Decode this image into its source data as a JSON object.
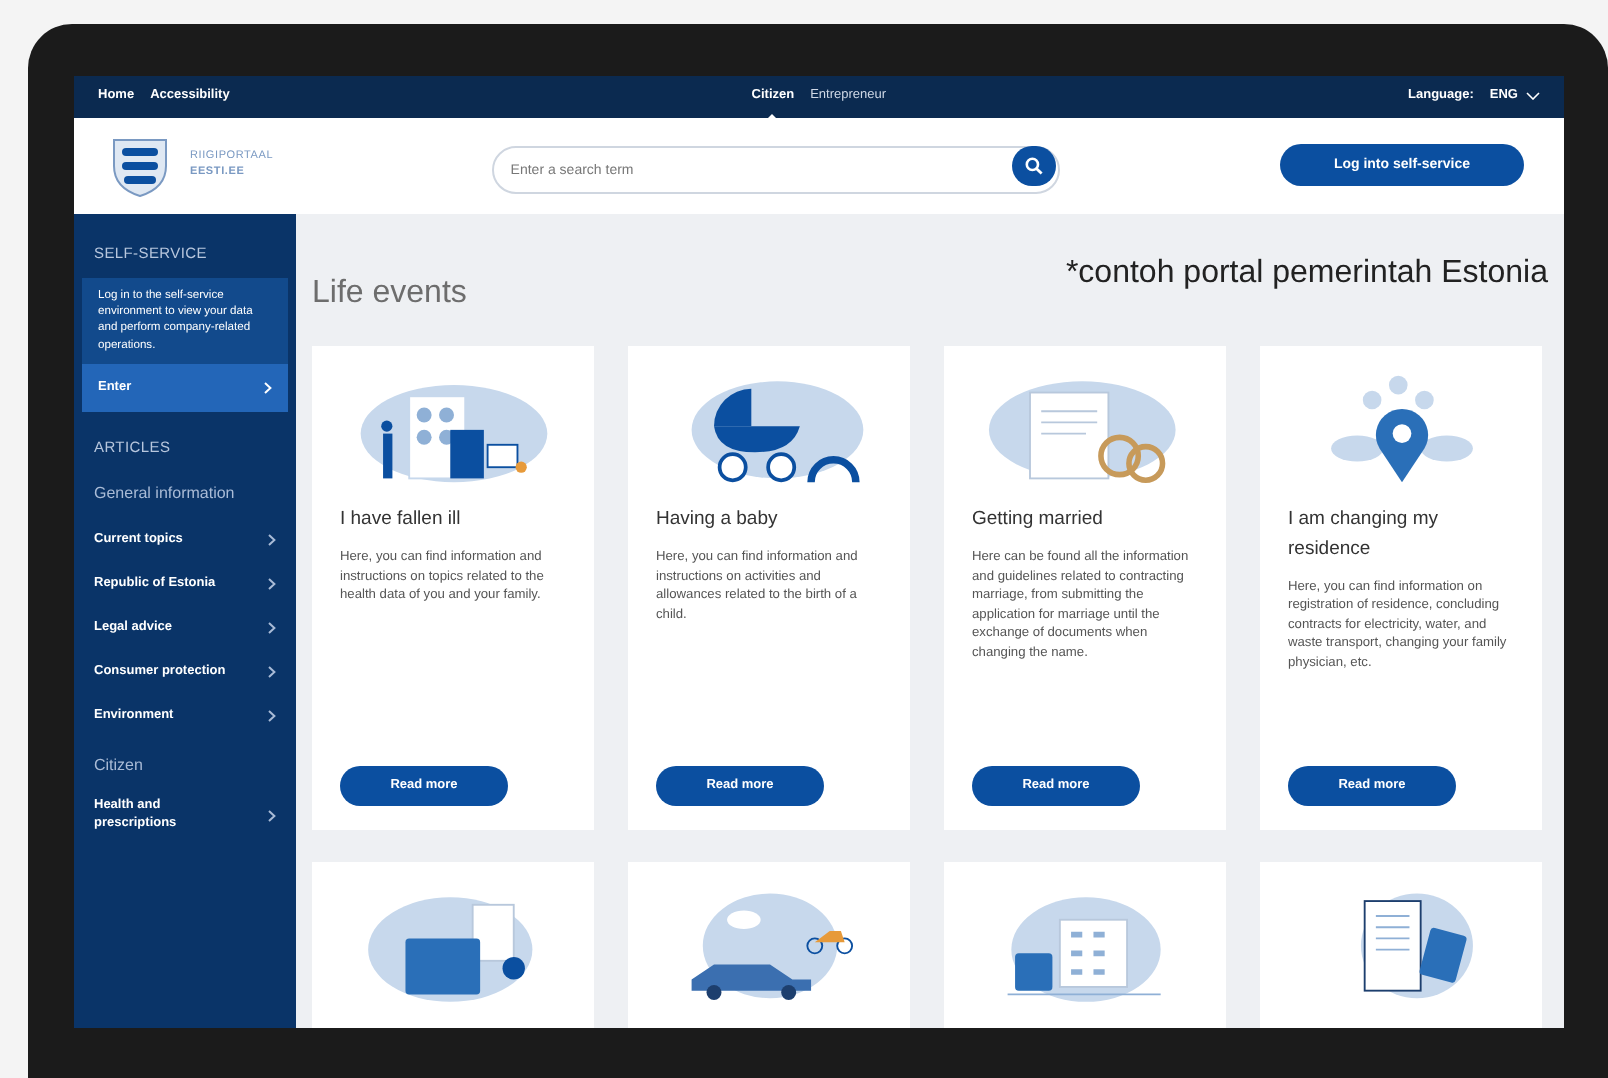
{
  "top_bar": {
    "left_links": [
      {
        "label": "Home"
      },
      {
        "label": "Accessibility"
      }
    ],
    "audience_tabs": [
      {
        "label": "Citizen",
        "selected": true
      },
      {
        "label": "Entrepreneur",
        "selected": false
      }
    ],
    "language": {
      "label": "Language:",
      "value": "ENG"
    }
  },
  "header": {
    "logo": {
      "line_1": "RIIGIPORTAAL",
      "line_2": "EESTI.EE"
    },
    "search": {
      "placeholder": "Enter a search term"
    },
    "login_button": "Log into self-service"
  },
  "sidebar": {
    "items": [
      {
        "kind": "heading",
        "label": "SELF-SERVICE"
      },
      {
        "kind": "note",
        "label": "Log in to the self-service environment to view your data and perform company-related operations."
      },
      {
        "kind": "button",
        "label": "Enter"
      },
      {
        "kind": "heading",
        "label": "ARTICLES"
      },
      {
        "kind": "group",
        "label": "General information"
      },
      {
        "kind": "link",
        "label": "Current topics"
      },
      {
        "kind": "link",
        "label": "Republic of Estonia"
      },
      {
        "kind": "link",
        "label": "Legal advice"
      },
      {
        "kind": "link",
        "label": "Consumer protection"
      },
      {
        "kind": "link",
        "label": "Environment"
      },
      {
        "kind": "group",
        "label": "Citizen"
      },
      {
        "kind": "link",
        "label": "Health and prescriptions"
      }
    ]
  },
  "main": {
    "title": "Life events",
    "annotation": "*contoh portal pemerintah Estonia",
    "cards": [
      {
        "kind": "full",
        "title": "I have fallen ill",
        "text": "Here, you can find information and instructions on topics related to the health data of you and your family.",
        "button": "Read more"
      },
      {
        "kind": "full",
        "title": "Having a baby",
        "text": "Here, you can find information and instructions on activities and allowances related to the birth of a child.",
        "button": "Read more"
      },
      {
        "kind": "full",
        "title": "Getting married",
        "text": "Here can be found all the information and guidelines related to contracting marriage, from submitting the application for marriage until the exchange of documents when changing the name.",
        "button": "Read more"
      },
      {
        "kind": "full",
        "title": "I am changing my residence",
        "text": "Here, you can find information on registration of residence, concluding contracts for electricity, water, and waste transport, changing your family physician, etc.",
        "button": "Read more"
      },
      {
        "kind": "cut"
      },
      {
        "kind": "cut"
      },
      {
        "kind": "cut"
      },
      {
        "kind": "cut"
      }
    ]
  }
}
